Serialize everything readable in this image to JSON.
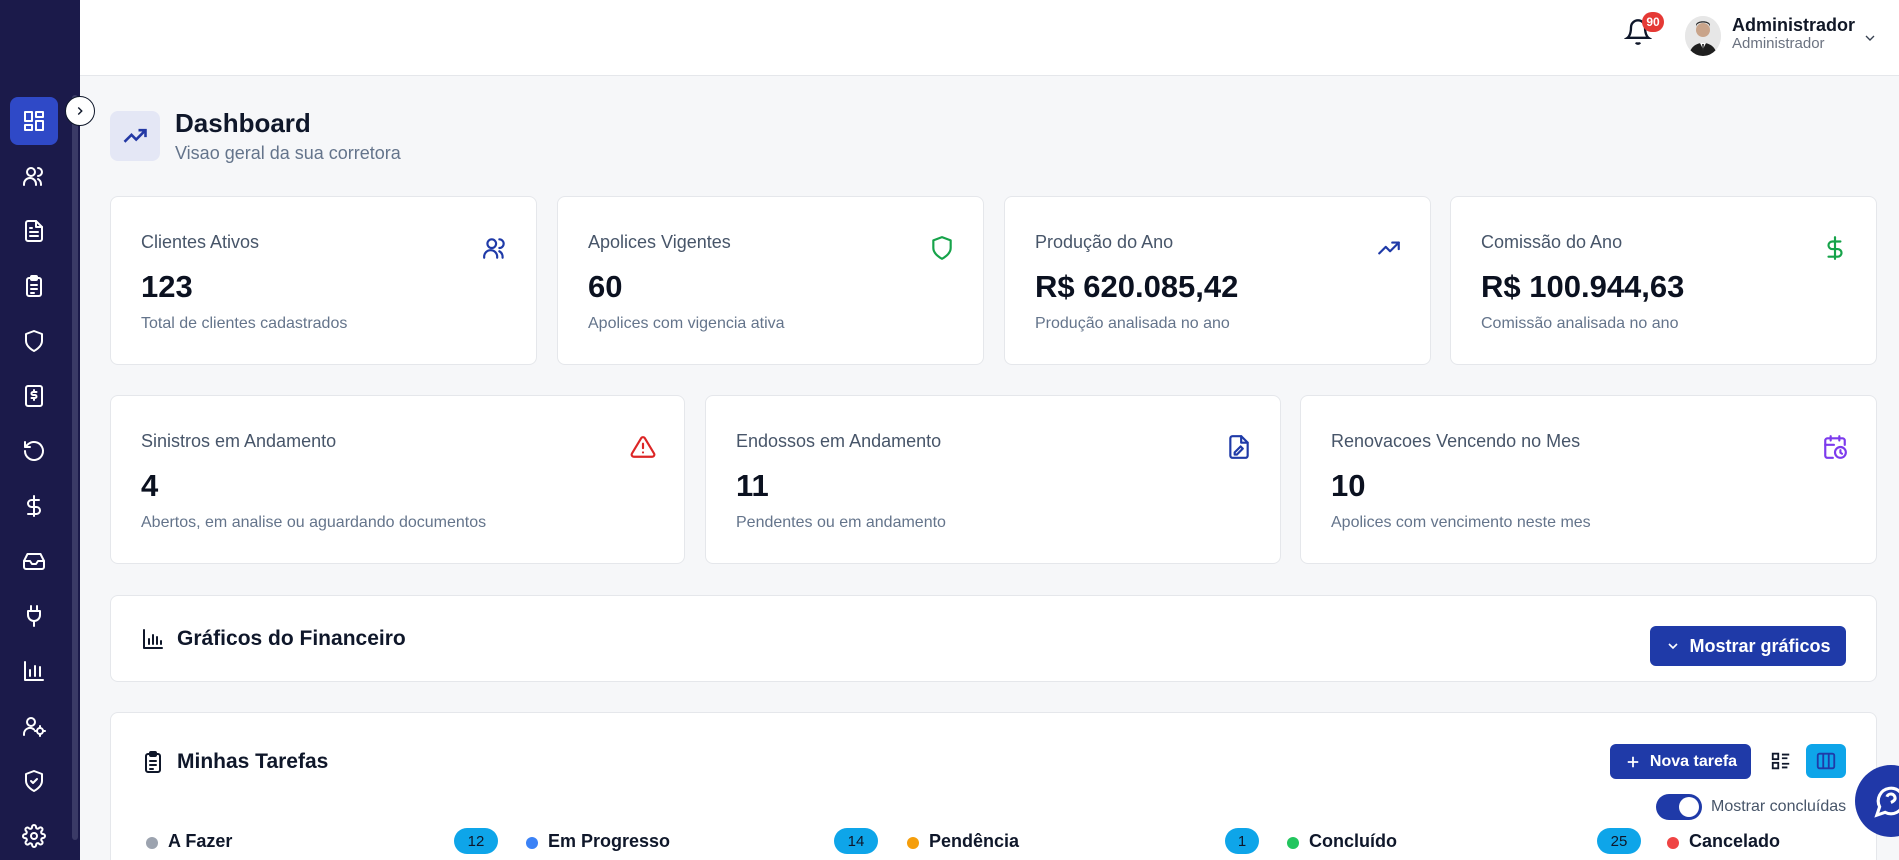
{
  "header": {
    "notification_count": "90",
    "user_name": "Administrador",
    "user_role": "Administrador"
  },
  "page": {
    "title": "Dashboard",
    "subtitle": "Visao geral da sua corretora"
  },
  "stats_row1": [
    {
      "label": "Clientes Ativos",
      "value": "123",
      "desc": "Total de clientes cadastrados",
      "icon": "users-icon",
      "color": "#1f3aa8"
    },
    {
      "label": "Apolices Vigentes",
      "value": "60",
      "desc": "Apolices com vigencia ativa",
      "icon": "shield-icon",
      "color": "#16a34a"
    },
    {
      "label": "Produção do Ano",
      "value": "R$ 620.085,42",
      "desc": "Produção analisada no ano",
      "icon": "trending-up-icon",
      "color": "#1f3aa8"
    },
    {
      "label": "Comissão do Ano",
      "value": "R$ 100.944,63",
      "desc": "Comissão analisada no ano",
      "icon": "dollar-icon",
      "color": "#16a34a"
    }
  ],
  "stats_row2": [
    {
      "label": "Sinistros em Andamento",
      "value": "4",
      "desc": "Abertos, em analise ou aguardando documentos",
      "icon": "alert-triangle-icon",
      "color": "#dc2626"
    },
    {
      "label": "Endossos em Andamento",
      "value": "11",
      "desc": "Pendentes ou em andamento",
      "icon": "file-edit-icon",
      "color": "#1f3aa8"
    },
    {
      "label": "Renovacoes Vencendo no Mes",
      "value": "10",
      "desc": "Apolices com vencimento neste mes",
      "icon": "calendar-clock-icon",
      "color": "#7c3aed"
    }
  ],
  "finance": {
    "title": "Gráficos do Financeiro",
    "button_label": "Mostrar gráficos"
  },
  "tasks": {
    "title": "Minhas Tarefas",
    "new_task_label": "Nova tarefa",
    "toggle_label": "Mostrar concluídas",
    "columns": [
      {
        "name": "A Fazer",
        "count": "12",
        "color": "#9ca3af"
      },
      {
        "name": "Em Progresso",
        "count": "14",
        "color": "#3b82f6"
      },
      {
        "name": "Pendência",
        "count": "1",
        "color": "#f59e0b"
      },
      {
        "name": "Concluído",
        "count": "25",
        "color": "#22c55e"
      },
      {
        "name": "Cancelado",
        "count": "",
        "color": "#ef4444"
      }
    ]
  }
}
